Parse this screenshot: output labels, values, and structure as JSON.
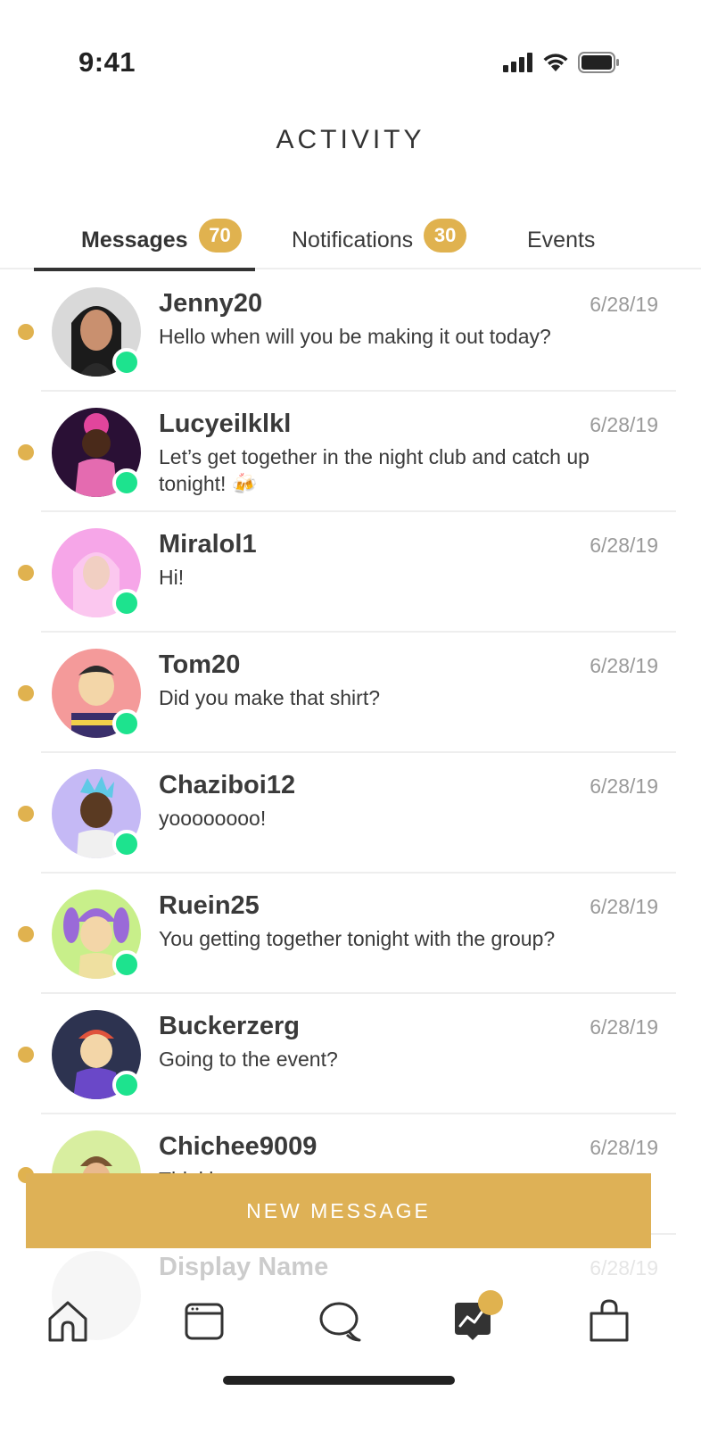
{
  "status": {
    "time": "9:41"
  },
  "header": {
    "title": "ACTIVITY"
  },
  "tabs": [
    {
      "label": "Messages",
      "badge": "70"
    },
    {
      "label": "Notifications",
      "badge": "30"
    },
    {
      "label": "Events"
    }
  ],
  "messages": [
    {
      "name": "Jenny20",
      "date": "6/28/19",
      "text": "Hello when will you be making it out today?",
      "avatar_bg": "#d9d9d9"
    },
    {
      "name": "Lucyeilklkl",
      "date": "6/28/19",
      "text": "Let’s get together in the night club and catch up tonight! 🍻",
      "avatar_bg": "#2a1035"
    },
    {
      "name": "Miralol1",
      "date": "6/28/19",
      "text": "Hi!",
      "avatar_bg": "#f6a6e8"
    },
    {
      "name": "Tom20",
      "date": "6/28/19",
      "text": "Did you make that shirt?",
      "avatar_bg": "#f49a9a"
    },
    {
      "name": "Chaziboi12",
      "date": "6/28/19",
      "text": "yoooooooo!",
      "avatar_bg": "#c5b9f5"
    },
    {
      "name": "Ruein25",
      "date": "6/28/19",
      "text": "You getting together tonight with the group?",
      "avatar_bg": "#c8ef8a"
    },
    {
      "name": "Buckerzerg",
      "date": "6/28/19",
      "text": "Going to the event?",
      "avatar_bg": "#2d3350"
    },
    {
      "name": "Chichee9009",
      "date": "6/28/19",
      "text": "Thinking...",
      "avatar_bg": "#d8eea0"
    },
    {
      "name": "Display Name",
      "date": "6/28/19",
      "text": "",
      "avatar_bg": "#dddddd"
    }
  ],
  "actions": {
    "new_message": "NEW MESSAGE"
  },
  "tab_bar": {
    "items": [
      "home-icon",
      "browser-icon",
      "chat-icon",
      "activity-icon",
      "shop-icon"
    ]
  },
  "colors": {
    "accent": "#e0b24f",
    "online": "#1de38e"
  }
}
